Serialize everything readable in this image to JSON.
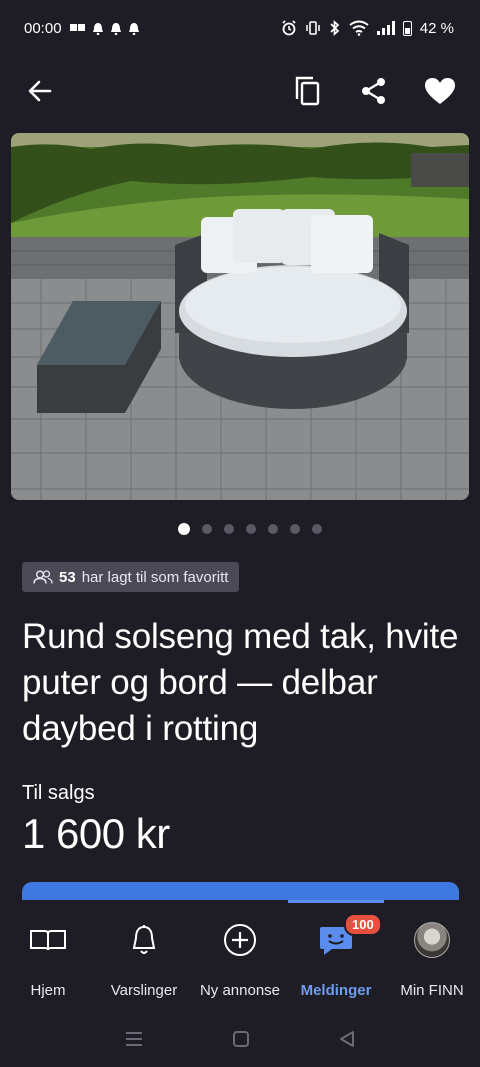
{
  "status_bar": {
    "time": "00:00",
    "battery": "42 %",
    "icons": [
      "sim-icon",
      "bell-icon",
      "bell-icon",
      "bell-icon",
      "alarm-icon",
      "vibrate-icon",
      "bluetooth-icon",
      "wifi-icon",
      "signal-icon",
      "battery-icon"
    ]
  },
  "app_bar": {
    "icons": [
      "back-arrow-icon",
      "copy-icon",
      "share-icon",
      "heart-icon"
    ]
  },
  "gallery": {
    "image_count": 7,
    "active_index": 0
  },
  "listing": {
    "favorites_count": "53",
    "favorites_text": "har lagt til som favoritt",
    "title": "Rund solseng med tak, hvite puter og bord — delbar daybed i rotting",
    "sale_label": "Til salgs",
    "price": "1 600 kr"
  },
  "bottom_nav": {
    "items": [
      {
        "label": "Hjem",
        "icon": "book-icon"
      },
      {
        "label": "Varslinger",
        "icon": "bell-icon"
      },
      {
        "label": "Ny annonse",
        "icon": "plus-circle-icon"
      },
      {
        "label": "Meldinger",
        "icon": "chat-icon",
        "badge": "100"
      },
      {
        "label": "Min FINN",
        "icon": "avatar"
      }
    ],
    "active": "Meldinger"
  },
  "colors": {
    "background": "#1e1c24",
    "accent": "#3f78e0",
    "active_nav": "#6f9bf2",
    "badge": "#e5503f"
  }
}
